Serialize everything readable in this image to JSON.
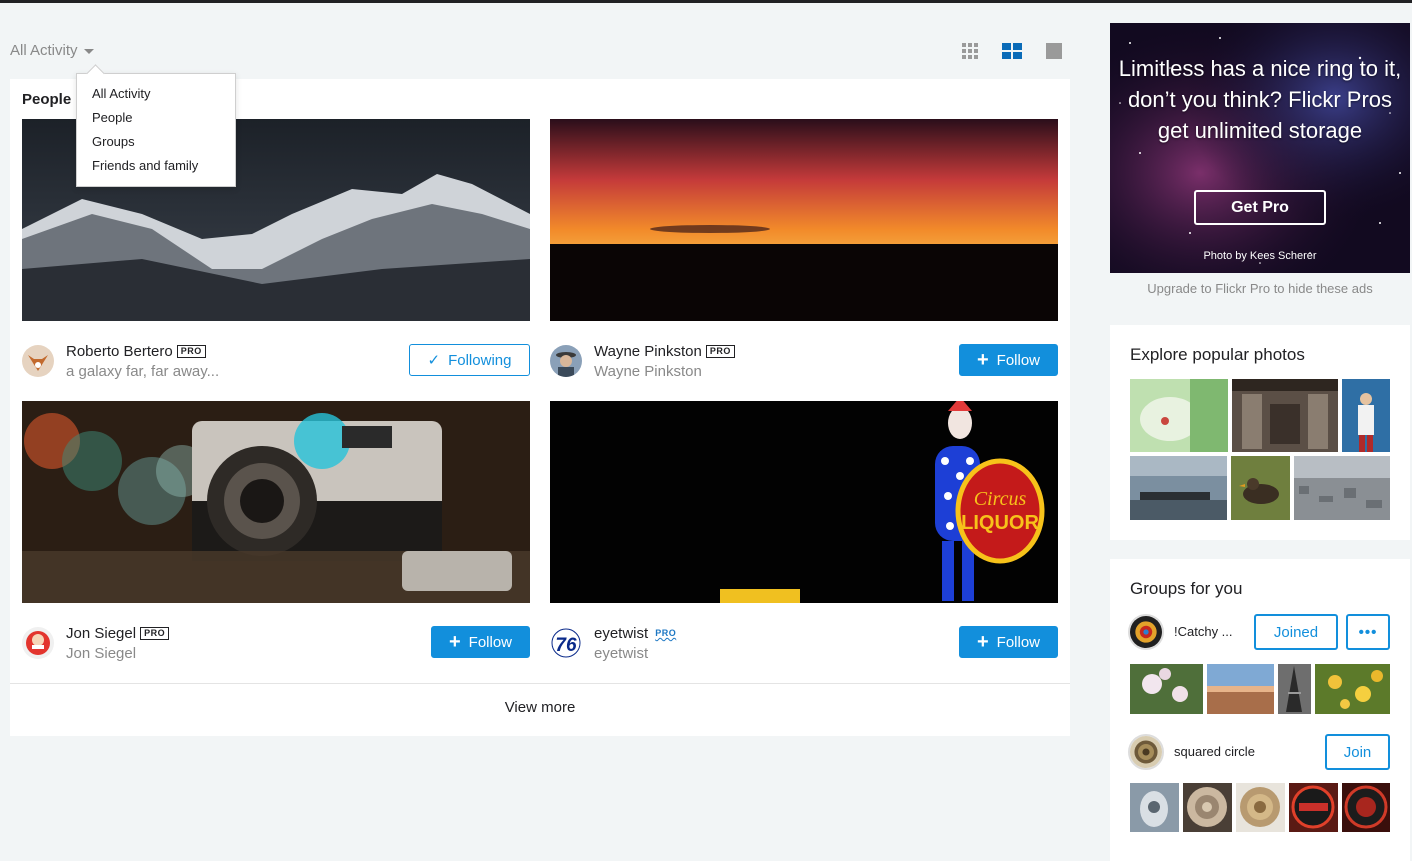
{
  "filter": {
    "label": "All Activity"
  },
  "dropdown": {
    "items": [
      "All Activity",
      "People",
      "Groups",
      "Friends and family"
    ]
  },
  "feed": {
    "section_title": "People",
    "users": [
      {
        "name": "Roberto Bertero",
        "pro": "PRO",
        "subtitle": "a galaxy far, far away...",
        "button": "Following"
      },
      {
        "name": "Wayne Pinkston",
        "pro": "PRO",
        "subtitle": "Wayne Pinkston",
        "button": "Follow"
      },
      {
        "name": "Jon Siegel",
        "pro": "PRO",
        "subtitle": "Jon Siegel",
        "button": "Follow"
      },
      {
        "name": "eyetwist",
        "pro": "PRO",
        "subtitle": "eyetwist",
        "button": "Follow"
      }
    ],
    "view_more": "View more"
  },
  "ad": {
    "headline": "Limitless has a nice ring to it, don’t you think? Flickr Pros get unlimited storage",
    "cta": "Get Pro",
    "credit": "Photo by Kees Scherer",
    "upgrade_link": "Upgrade to Flickr Pro to hide these ads"
  },
  "explore": {
    "title": "Explore popular photos"
  },
  "groups": {
    "title": "Groups for you",
    "items": [
      {
        "name": "!Catchy ...",
        "button": "Joined",
        "more": "•••"
      },
      {
        "name": "squared circle",
        "button": "Join"
      }
    ]
  },
  "colors": {
    "accent": "#128fdc",
    "text": "#212124",
    "muted": "#898989",
    "background": "#f2f5f6"
  }
}
